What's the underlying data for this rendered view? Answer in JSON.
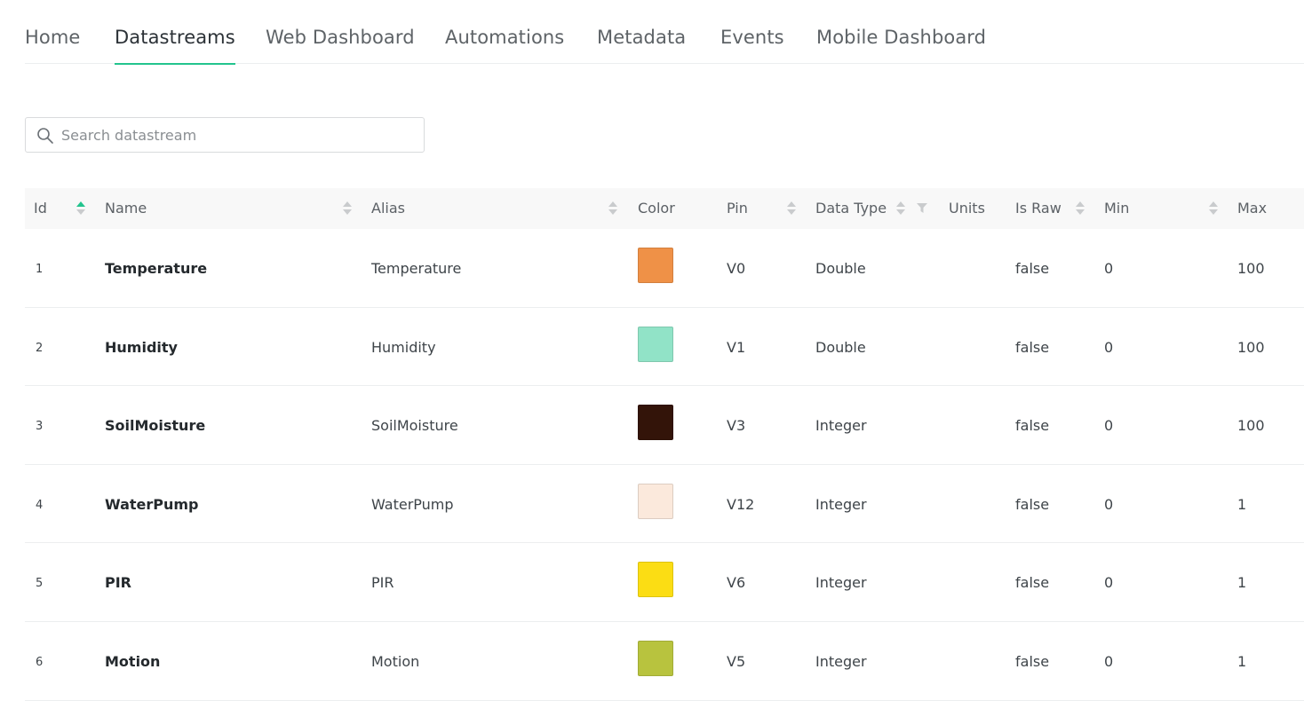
{
  "tabs": [
    {
      "label": "Home"
    },
    {
      "label": "Datastreams",
      "active": true
    },
    {
      "label": "Web Dashboard"
    },
    {
      "label": "Automations"
    },
    {
      "label": "Metadata"
    },
    {
      "label": "Events"
    },
    {
      "label": "Mobile Dashboard"
    }
  ],
  "search": {
    "placeholder": "Search datastream",
    "value": "",
    "icon": "search-icon"
  },
  "table": {
    "columns": {
      "id": "Id",
      "name": "Name",
      "alias": "Alias",
      "color": "Color",
      "pin": "Pin",
      "data_type": "Data Type",
      "units": "Units",
      "is_raw": "Is Raw",
      "min": "Min",
      "max": "Max"
    },
    "sort": {
      "column": "Id",
      "direction": "ascending"
    },
    "rows": [
      {
        "id": "1",
        "name": "Temperature",
        "alias": "Temperature",
        "color": "#ef9147",
        "pin": "V0",
        "data_type": "Double",
        "units": "",
        "is_raw": "false",
        "min": "0",
        "max": "100"
      },
      {
        "id": "2",
        "name": "Humidity",
        "alias": "Humidity",
        "color": "#91e3c7",
        "pin": "V1",
        "data_type": "Double",
        "units": "",
        "is_raw": "false",
        "min": "0",
        "max": "100"
      },
      {
        "id": "3",
        "name": "SoilMoisture",
        "alias": "SoilMoisture",
        "color": "#331409",
        "pin": "V3",
        "data_type": "Integer",
        "units": "",
        "is_raw": "false",
        "min": "0",
        "max": "100"
      },
      {
        "id": "4",
        "name": "WaterPump",
        "alias": "WaterPump",
        "color": "#fbe9dc",
        "pin": "V12",
        "data_type": "Integer",
        "units": "",
        "is_raw": "false",
        "min": "0",
        "max": "1"
      },
      {
        "id": "5",
        "name": "PIR",
        "alias": "PIR",
        "color": "#fbdd14",
        "pin": "V6",
        "data_type": "Integer",
        "units": "",
        "is_raw": "false",
        "min": "0",
        "max": "1"
      },
      {
        "id": "6",
        "name": "Motion",
        "alias": "Motion",
        "color": "#b8c33e",
        "pin": "V5",
        "data_type": "Integer",
        "units": "",
        "is_raw": "false",
        "min": "0",
        "max": "1"
      }
    ]
  },
  "colors": {
    "accent": "#23c48e"
  }
}
